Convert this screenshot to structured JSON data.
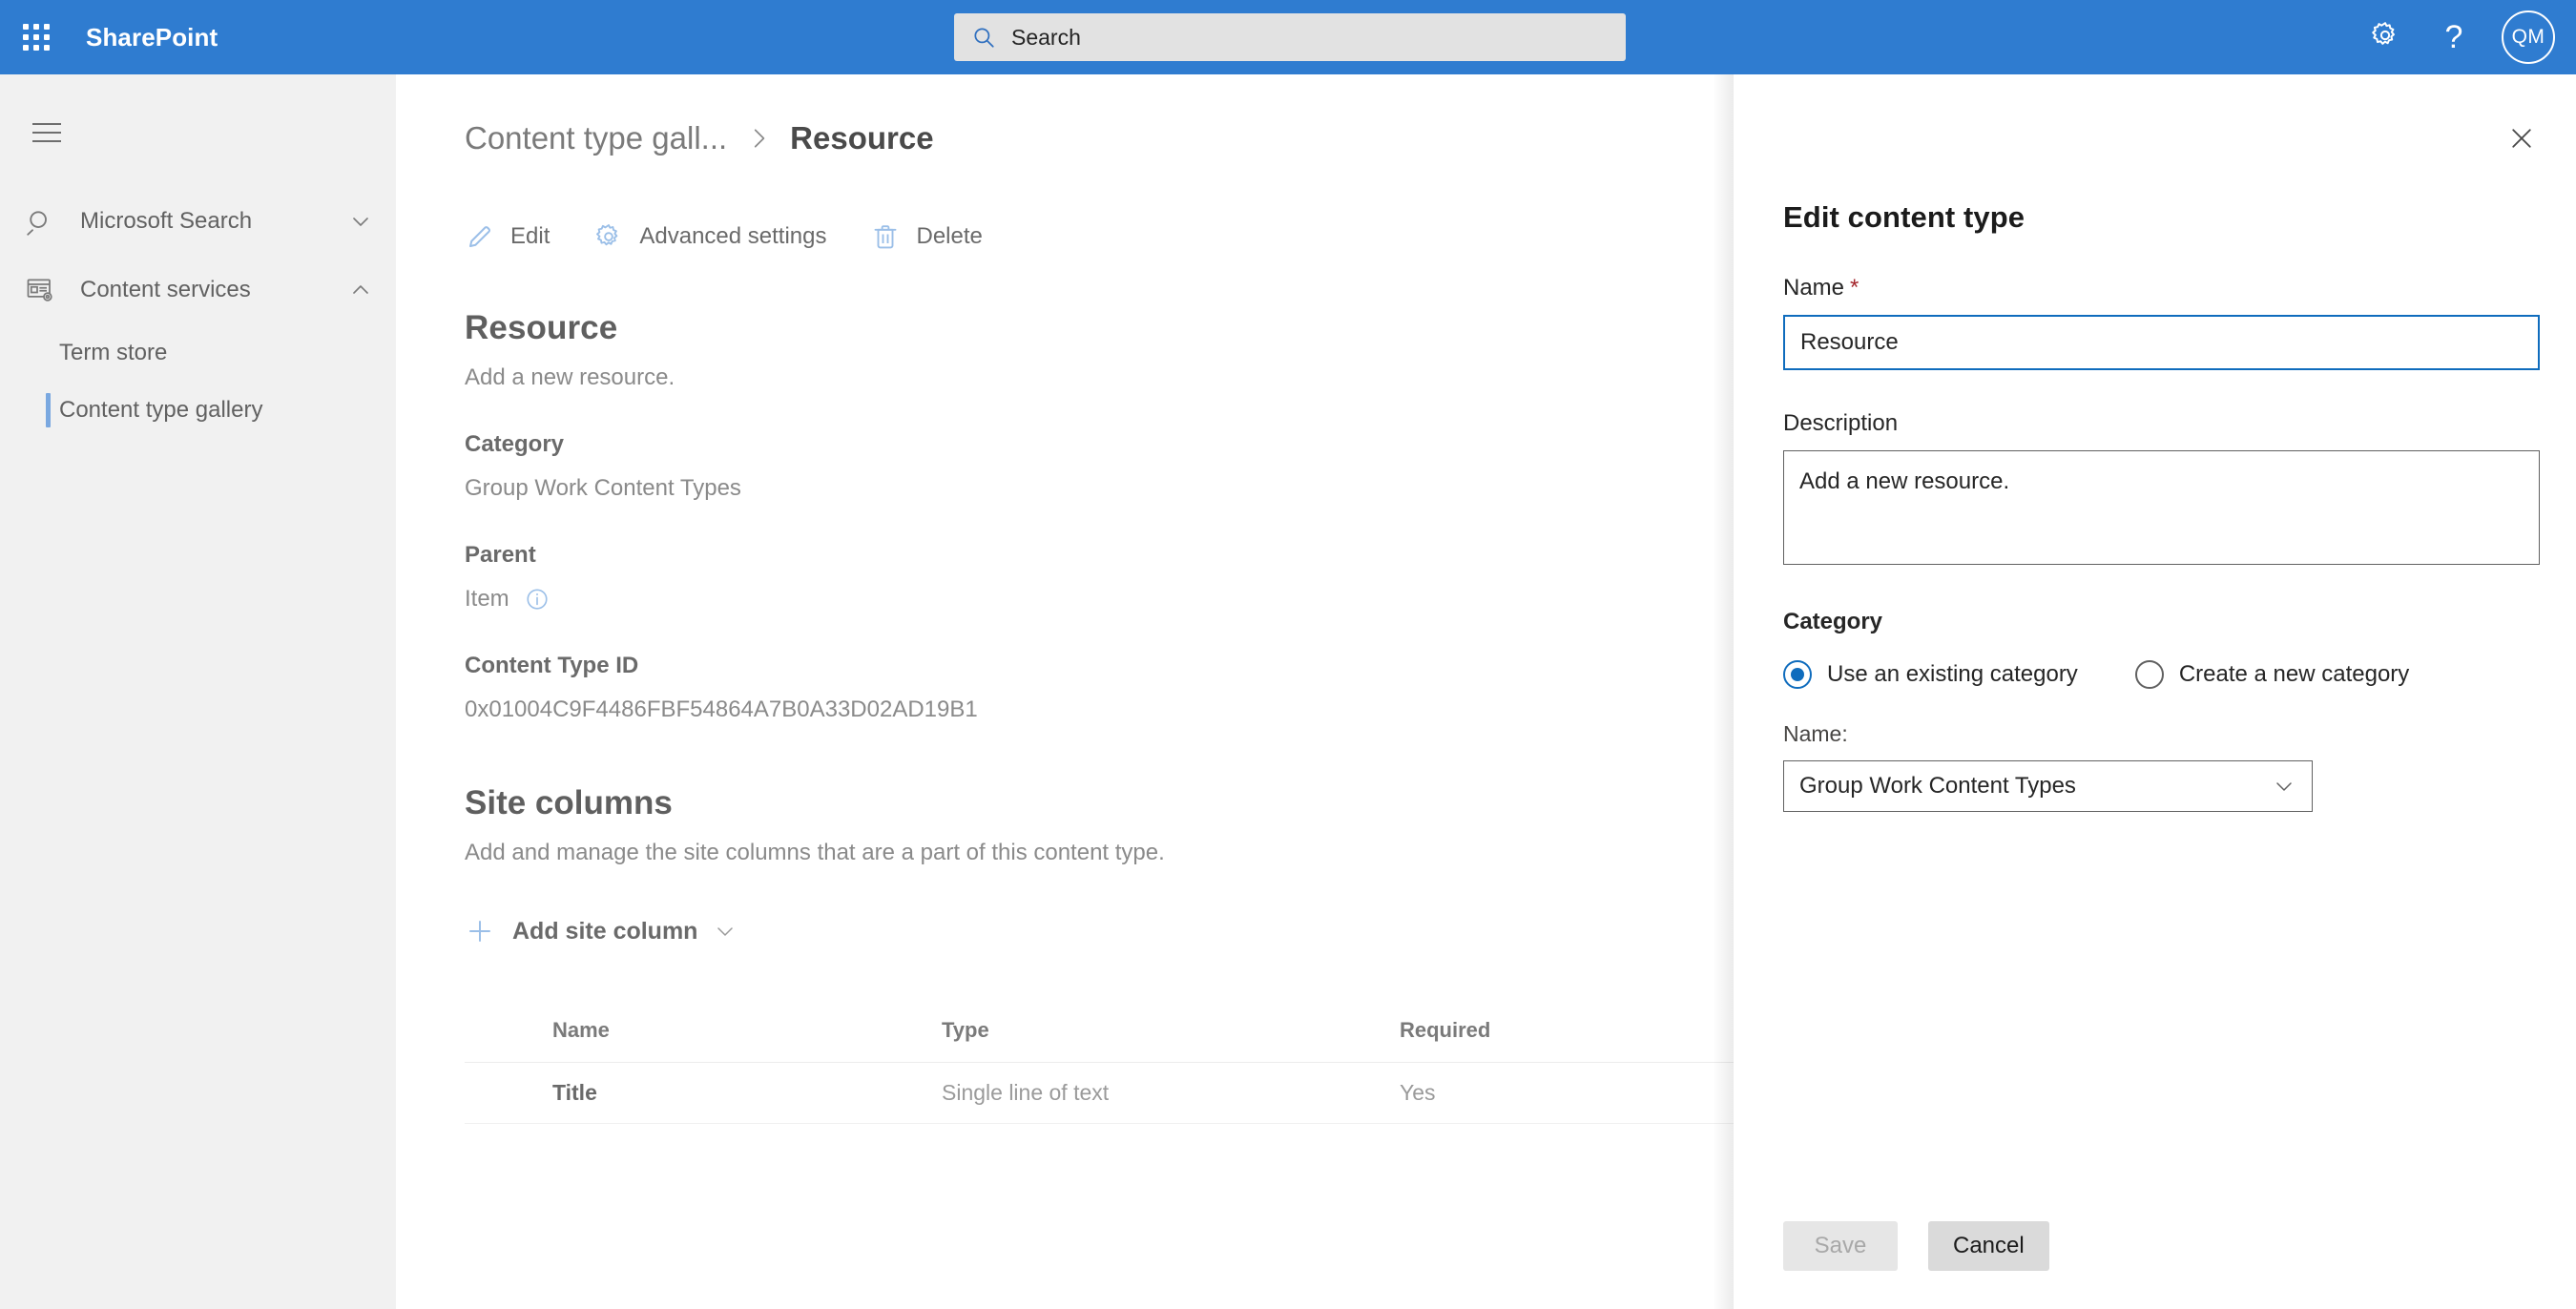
{
  "suite": {
    "brand": "SharePoint",
    "waffle_icon": "app-launcher-icon",
    "search": {
      "icon": "search-icon",
      "placeholder": "Search",
      "value": ""
    },
    "settings_icon": "gear-icon",
    "help_icon": "question-mark-icon",
    "help_label": "?",
    "avatar_initials": "QM",
    "brand_color": "#2f7cd0"
  },
  "sidebar": {
    "menu_icon": "hamburger-icon",
    "items": [
      {
        "label": "Microsoft Search",
        "icon": "magnifier-icon",
        "chevron": "chevron-down-icon",
        "expanded": false,
        "children": []
      },
      {
        "label": "Content services",
        "icon": "content-services-icon",
        "chevron": "chevron-up-icon",
        "expanded": true,
        "children": [
          {
            "label": "Term store",
            "selected": false
          },
          {
            "label": "Content type gallery",
            "selected": true
          }
        ]
      }
    ],
    "selected_accent": "#7aa8e0"
  },
  "main": {
    "breadcrumb": {
      "parent": "Content type gall...",
      "separator_icon": "chevron-right-icon",
      "current": "Resource"
    },
    "commands": [
      {
        "label": "Edit",
        "icon": "pencil-icon"
      },
      {
        "label": "Advanced settings",
        "icon": "gear-icon"
      },
      {
        "label": "Delete",
        "icon": "trash-icon"
      }
    ],
    "content_type": {
      "title": "Resource",
      "description": "Add a new resource.",
      "fields": [
        {
          "label": "Category",
          "value": "Group Work Content Types",
          "has_info": false
        },
        {
          "label": "Parent",
          "value": "Item",
          "has_info": true,
          "info_icon": "info-icon"
        },
        {
          "label": "Content Type ID",
          "value": "0x01004C9F4486FBF54864A7B0A33D02AD19B1",
          "has_info": false
        }
      ]
    },
    "site_columns": {
      "heading": "Site columns",
      "description": "Add and manage the site columns that are a part of this content type.",
      "add_button": {
        "label": "Add site column",
        "plus_icon": "plus-icon",
        "chevron_icon": "chevron-down-icon"
      },
      "table": {
        "headers": [
          "Name",
          "Type",
          "Required"
        ],
        "rows": [
          {
            "name": "Title",
            "type": "Single line of text",
            "required": "Yes"
          }
        ]
      }
    }
  },
  "panel": {
    "close_icon": "close-icon",
    "title": "Edit content type",
    "name_field": {
      "label": "Name",
      "required_marker": "*",
      "value": "Resource"
    },
    "description_field": {
      "label": "Description",
      "value": "Add a new resource."
    },
    "category": {
      "label": "Category",
      "options": [
        {
          "label": "Use an existing category",
          "selected": true
        },
        {
          "label": "Create a new category",
          "selected": false
        }
      ],
      "name_label": "Name:",
      "select_value": "Group Work Content Types",
      "select_chevron": "chevron-down-icon"
    },
    "footer": {
      "save_label": "Save",
      "save_disabled": true,
      "cancel_label": "Cancel"
    },
    "accent_color": "#0f6cbd"
  }
}
